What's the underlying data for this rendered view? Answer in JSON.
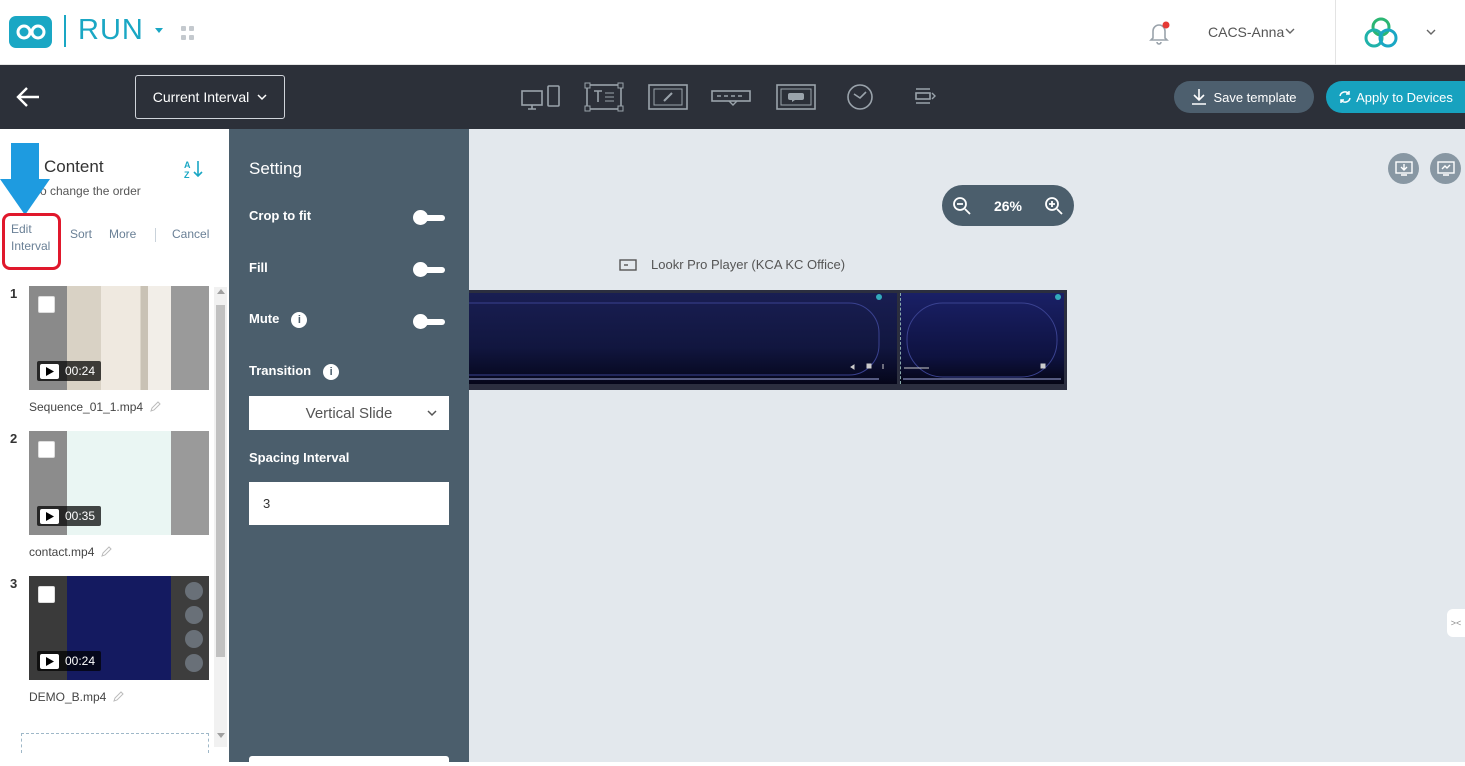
{
  "header": {
    "app_name": "RUN",
    "user_name": "CACS-Anna"
  },
  "toolbar": {
    "interval_label": "Current Interval",
    "save_label": "Save template",
    "apply_label": "Apply to Devices"
  },
  "content_panel": {
    "title": "Content",
    "subtitle": "o change the order",
    "actions": {
      "edit_interval": "Edit Interval",
      "sort": "Sort",
      "more": "More",
      "cancel": "Cancel"
    },
    "items": [
      {
        "index": "1",
        "duration": "00:24",
        "filename": "Sequence_01_1.mp4"
      },
      {
        "index": "2",
        "duration": "00:35",
        "filename": "contact.mp4"
      },
      {
        "index": "3",
        "duration": "00:24",
        "filename": "DEMO_B.mp4"
      }
    ]
  },
  "settings": {
    "title": "Setting",
    "crop_to_fit": "Crop to fit",
    "fill": "Fill",
    "mute": "Mute",
    "transition": "Transition",
    "transition_value": "Vertical Slide",
    "spacing_interval": "Spacing Interval",
    "spacing_value": "3"
  },
  "canvas": {
    "zoom_level": "26%",
    "player_label": "Lookr Pro Player (KCA KC Office)"
  },
  "colors": {
    "accent": "#1aa7c4",
    "toolbar_bg": "#2c3039",
    "settings_bg": "#4b5e6c",
    "canvas_bg": "#e3e8ed",
    "highlight_red": "#e0182c",
    "arrow_blue": "#1e9be0"
  }
}
